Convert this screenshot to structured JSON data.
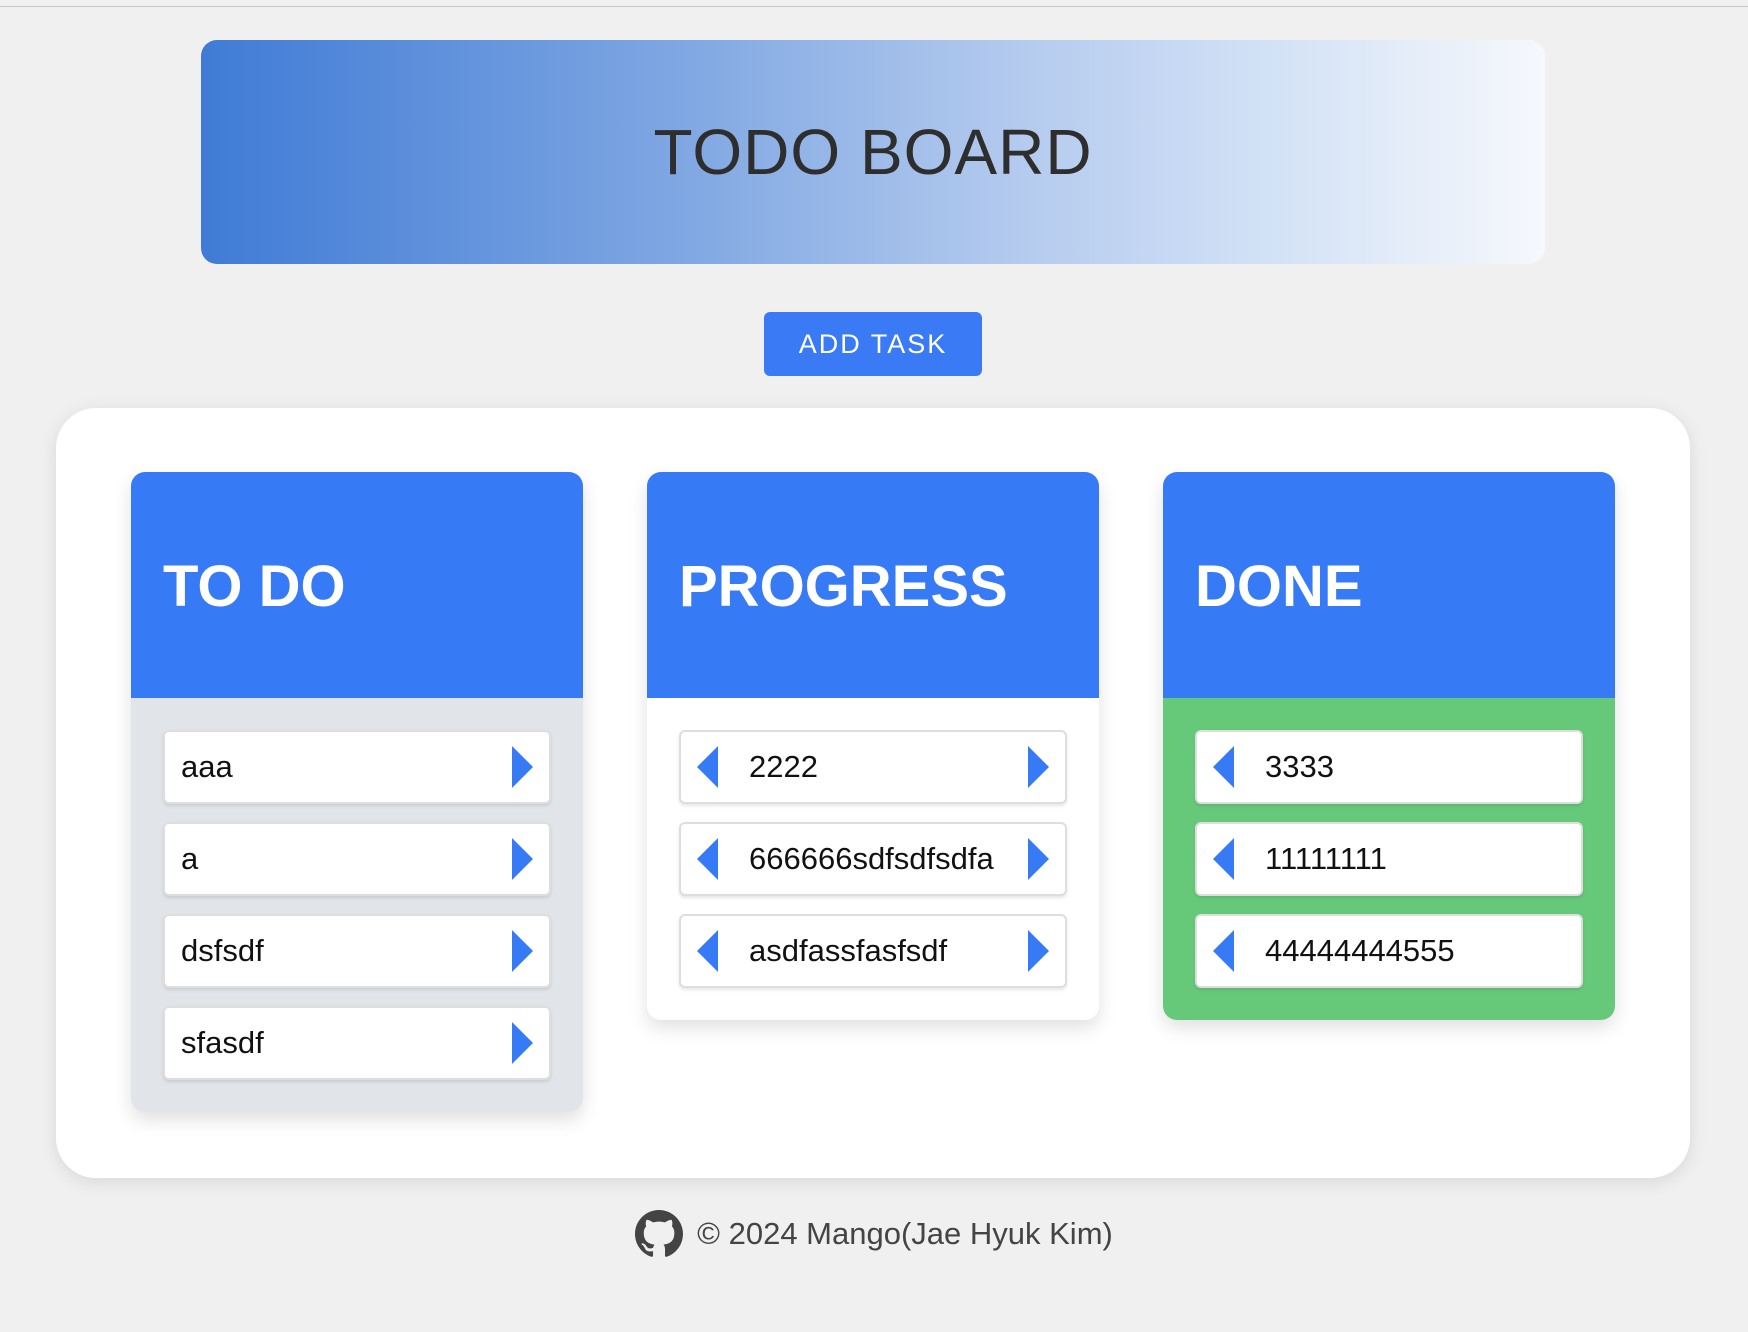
{
  "header": {
    "title": "TODO BOARD"
  },
  "toolbar": {
    "add_label": "ADD TASK"
  },
  "columns": {
    "todo": {
      "title": "TO DO",
      "cards": [
        "aaa",
        "a",
        "dsfsdf",
        "sfasdf"
      ]
    },
    "progress": {
      "title": "PROGRESS",
      "cards": [
        "2222",
        "666666sdfsdfsdfa",
        "asdfassfasfsdf"
      ]
    },
    "done": {
      "title": "DONE",
      "cards": [
        "3333",
        "11111111",
        "44444444555"
      ]
    }
  },
  "footer": {
    "icon": "github-icon",
    "text": "© 2024 Mango(Jae Hyuk Kim)"
  },
  "colors": {
    "accent": "#377af5",
    "todo_body": "#e1e4e8",
    "progress_body": "#ffffff",
    "done_body": "#66c97a",
    "page_bg": "#f0f0f0"
  }
}
